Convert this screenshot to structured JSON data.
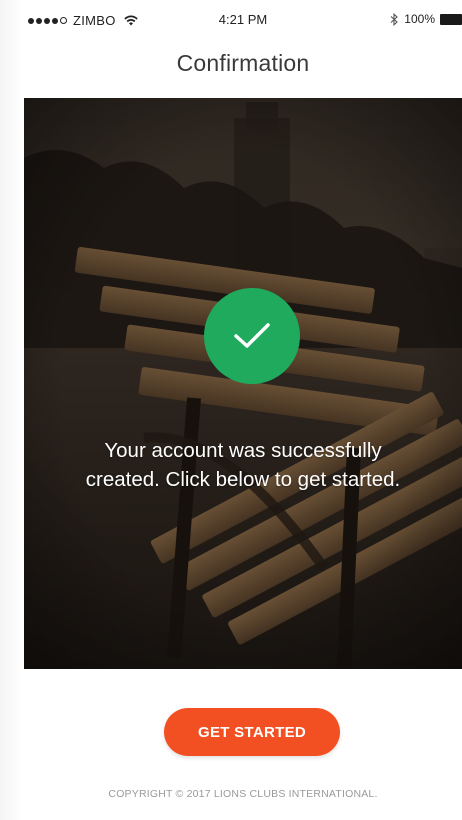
{
  "status_bar": {
    "carrier": "ZIMBO",
    "time": "4:21 PM",
    "battery": "100%",
    "signal_icon": "signal-dots-icon",
    "wifi_icon": "wifi-icon",
    "bluetooth_icon": "bluetooth-icon",
    "battery_icon": "battery-icon"
  },
  "header": {
    "title": "Confirmation"
  },
  "hero": {
    "success_icon": "checkmark-icon",
    "badge_color": "#1faa5e",
    "message_line1": "Your account was successfully",
    "message_line2": "created. Click below to get started."
  },
  "actions": {
    "get_started_label": "GET STARTED",
    "button_color": "#f25022"
  },
  "footer": {
    "copyright": "COPYRIGHT © 2017 LIONS CLUBS INTERNATIONAL."
  }
}
